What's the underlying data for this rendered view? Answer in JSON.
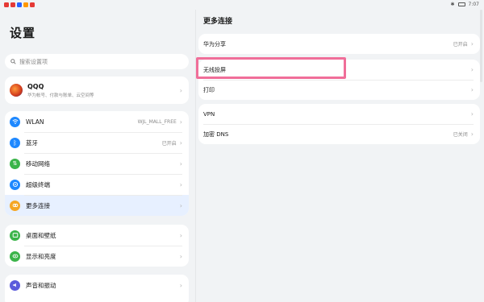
{
  "status_bar": {
    "time": "7:07"
  },
  "left_pane": {
    "title": "设置",
    "search_placeholder": "搜索设置项",
    "account": {
      "name": "QQQ",
      "subtitle": "华为帐号、付款与账单、云空间等"
    },
    "group1": [
      {
        "label": "WLAN",
        "value": "WJL_MALL_FREE",
        "icon": "wifi-icon",
        "color": "#1e88ff"
      },
      {
        "label": "蓝牙",
        "value": "已开启",
        "icon": "bluetooth-icon",
        "color": "#1e88ff"
      },
      {
        "label": "移动网络",
        "value": "",
        "icon": "mobile-network-icon",
        "color": "#3bb44a"
      },
      {
        "label": "超级终端",
        "value": "",
        "icon": "super-device-icon",
        "color": "#1e88ff"
      },
      {
        "label": "更多连接",
        "value": "",
        "icon": "more-connections-icon",
        "color": "#f5a623"
      }
    ],
    "group2": [
      {
        "label": "桌面和壁纸",
        "icon": "desktop-wallpaper-icon",
        "color": "#3bb44a"
      },
      {
        "label": "显示和亮度",
        "icon": "display-brightness-icon",
        "color": "#3bb44a"
      }
    ],
    "group3": [
      {
        "label": "声音和振动",
        "icon": "sound-vibration-icon",
        "color": "#5b5bdb"
      }
    ]
  },
  "right_pane": {
    "title": "更多连接",
    "card1": [
      {
        "label": "华为分享",
        "value": "已开启"
      }
    ],
    "card2": [
      {
        "label": "无线投屏",
        "value": ""
      },
      {
        "label": "打印",
        "value": ""
      }
    ],
    "card3": [
      {
        "label": "VPN",
        "value": ""
      },
      {
        "label": "加密 DNS",
        "value": "已关闭"
      }
    ]
  }
}
